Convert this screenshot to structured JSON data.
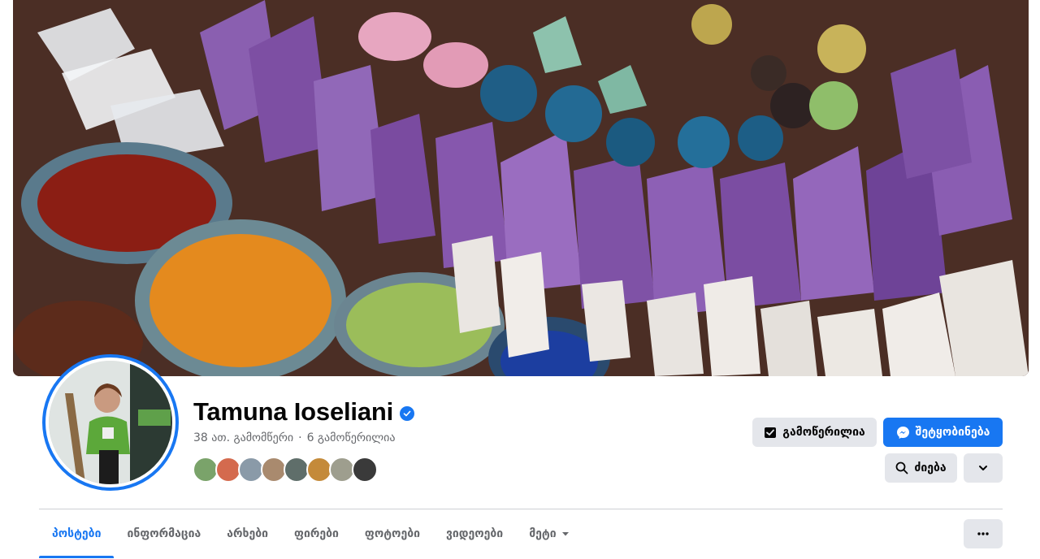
{
  "profile": {
    "name": "Tamuna Ioseliani",
    "verified": true,
    "followers_text": "38 ათ. გამომწერი",
    "following_text": "6 გამოწერილია",
    "separator": "·",
    "friend_avatars_count": 8
  },
  "actions": {
    "following_label": "გამოწერილია",
    "message_label": "შეტყობინება",
    "search_label": "ძიება"
  },
  "tabs": [
    {
      "label": "პოსტები",
      "active": true
    },
    {
      "label": "ინფორმაცია",
      "active": false
    },
    {
      "label": "არხები",
      "active": false
    },
    {
      "label": "ფირები",
      "active": false
    },
    {
      "label": "ფოტოები",
      "active": false
    },
    {
      "label": "ვიდეოები",
      "active": false
    },
    {
      "label": "მეტი",
      "active": false
    }
  ],
  "colors": {
    "accent": "#1877f2",
    "button_grey": "#e4e6eb",
    "secondary_text": "#65676b",
    "primary_text": "#050505"
  },
  "icons": {
    "verified": "verified-badge-icon",
    "following": "following-check-icon",
    "message": "messenger-icon",
    "search": "search-icon",
    "chevron": "chevron-down-icon",
    "more": "more-dots-icon",
    "tab_dropdown": "caret-down-icon"
  }
}
